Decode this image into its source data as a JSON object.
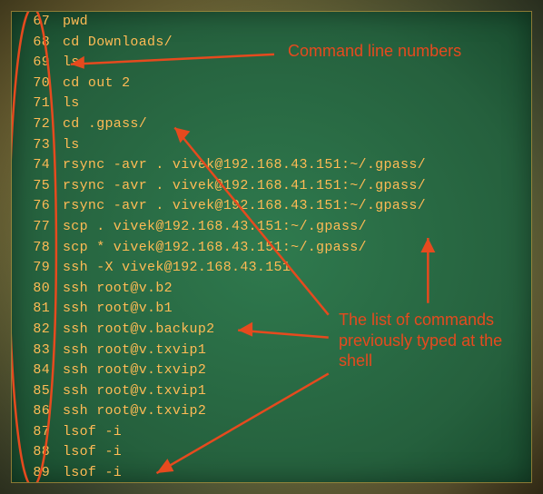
{
  "annotations": {
    "line_numbers": "Command line numbers",
    "command_list": "The list of commands previously typed at the shell"
  },
  "history": [
    {
      "n": "67",
      "cmd": "pwd"
    },
    {
      "n": "68",
      "cmd": "cd Downloads/"
    },
    {
      "n": "69",
      "cmd": "ls"
    },
    {
      "n": "70",
      "cmd": "cd out 2"
    },
    {
      "n": "71",
      "cmd": "ls"
    },
    {
      "n": "72",
      "cmd": "cd .gpass/"
    },
    {
      "n": "73",
      "cmd": "ls"
    },
    {
      "n": "74",
      "cmd": "rsync -avr . vivek@192.168.43.151:~/.gpass/"
    },
    {
      "n": "75",
      "cmd": "rsync -avr . vivek@192.168.41.151:~/.gpass/"
    },
    {
      "n": "76",
      "cmd": "rsync -avr . vivek@192.168.43.151:~/.gpass/"
    },
    {
      "n": "77",
      "cmd": "scp . vivek@192.168.43.151:~/.gpass/"
    },
    {
      "n": "78",
      "cmd": "scp * vivek@192.168.43.151:~/.gpass/"
    },
    {
      "n": "79",
      "cmd": "ssh -X vivek@192.168.43.151"
    },
    {
      "n": "80",
      "cmd": "ssh root@v.b2"
    },
    {
      "n": "81",
      "cmd": "ssh root@v.b1"
    },
    {
      "n": "82",
      "cmd": "ssh root@v.backup2"
    },
    {
      "n": "83",
      "cmd": "ssh root@v.txvip1"
    },
    {
      "n": "84",
      "cmd": "ssh root@v.txvip2"
    },
    {
      "n": "85",
      "cmd": "ssh root@v.txvip1"
    },
    {
      "n": "86",
      "cmd": "ssh root@v.txvip2"
    },
    {
      "n": "87",
      "cmd": "lsof -i"
    },
    {
      "n": "88",
      "cmd": "lsof -i"
    },
    {
      "n": "89",
      "cmd": "lsof -i"
    }
  ]
}
